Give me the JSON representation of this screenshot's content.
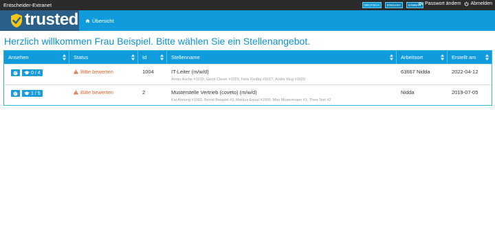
{
  "topbar": {
    "title": "Entscheider-Extranet",
    "languages": [
      "DEUTSCH",
      "ENGLISH",
      "SÄMBAR"
    ],
    "password_label": "Passwort ändern",
    "logout_label": "Abmelden"
  },
  "nav": {
    "brand": "trusted",
    "overview_label": "Übersicht"
  },
  "heading": "Herzlich willkommen Frau Beispiel. Bitte wählen Sie ein Stellenangebot.",
  "table": {
    "headers": [
      "Ansehen",
      "Status",
      "Id",
      "Stellenname",
      "Arbeitsort",
      "Erstellt am"
    ],
    "rows": [
      {
        "count": "0 / 4",
        "status": "Bitte bewerten",
        "id": "1004",
        "name": "IT-Leiter (m/w/d)",
        "candidates": "Armin Asche #1010, Gerrit Clever #1029, Felix Fleißig #1017, Andre Klug #1020",
        "location": "63667 Nidda",
        "created": "2022-04-12"
      },
      {
        "count": "1 / 5",
        "status": "Bitte bewerten",
        "id": "2",
        "name": "Musterstelle Vertrieb (coveto) (m/w/d)",
        "candidates": "Kai Ahnung #1002, Bernd Beispiel #3, Markus Equal #1000, Max Mustermann #1, Thea Test #2",
        "location": "Nidda",
        "created": "2019-07-05"
      }
    ]
  },
  "colors": {
    "topbar": "#2b2b2b",
    "nav": "#0f9bdc",
    "brand_bg": "#2a5f8a",
    "accent": "#0c93cf",
    "status": "#e8642c"
  }
}
